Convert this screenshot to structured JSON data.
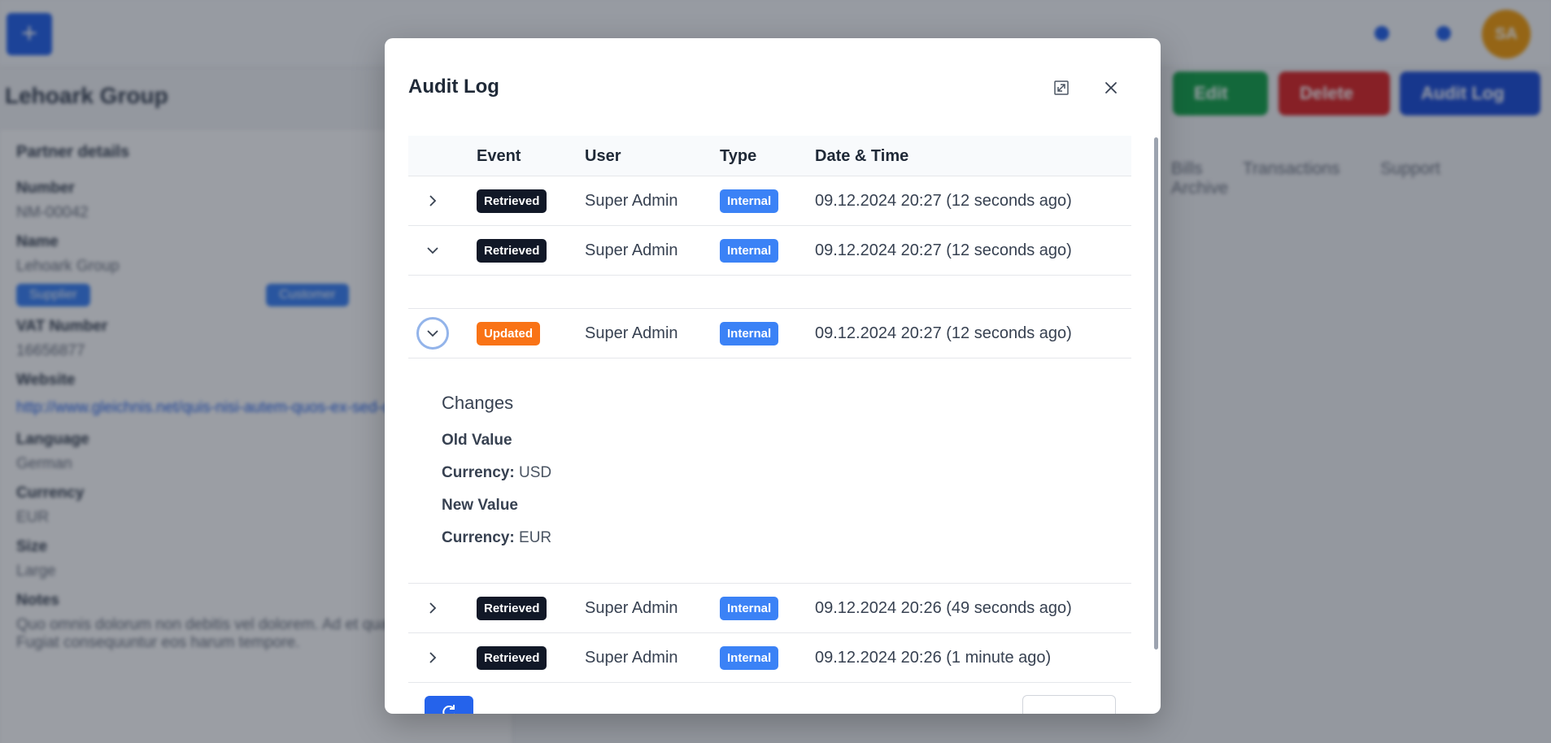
{
  "background": {
    "page_title": "Lehoark Group",
    "avatar_initials": "SA",
    "actions": [
      {
        "label": "Edit",
        "color": "#16a34a"
      },
      {
        "label": "Delete",
        "color": "#dc2626"
      },
      {
        "label": "Audit Log",
        "color": "#1d4ed8"
      }
    ],
    "tabs": [
      "Bills",
      "Transactions",
      "Support",
      "Archive"
    ],
    "details_heading": "Partner details",
    "fields": [
      {
        "label": "Number",
        "value": "NM-00042"
      },
      {
        "label": "Name",
        "value": "Lehoark Group"
      }
    ],
    "pills": [
      "Supplier",
      "Customer"
    ],
    "fields2": [
      {
        "label": "VAT Number",
        "value": "16656877"
      },
      {
        "label": "Website",
        "value": "http://www.gleichnis.net/quis-nisi-autem-quos-ex-sed-cum-pariatur"
      },
      {
        "label": "Language",
        "value": "German"
      },
      {
        "label": "Currency",
        "value": "EUR"
      },
      {
        "label": "Size",
        "value": "Large"
      },
      {
        "label": "Notes",
        "value": "Quo omnis dolorum non debitis vel dolorem. Ad et quas sunt sapiente. Fugiat consequuntur eos harum tempore."
      }
    ]
  },
  "modal": {
    "title": "Audit Log",
    "columns": {
      "event": "Event",
      "user": "User",
      "type": "Type",
      "datetime": "Date & Time"
    },
    "badge_colors": {
      "Retrieved": "#111827",
      "Updated": "#f97316",
      "Internal": "#3b82f6"
    },
    "rows": [
      {
        "event": "Retrieved",
        "user": "Super Admin",
        "type": "Internal",
        "datetime": "09.12.2024 20:27 (12 seconds ago)",
        "expanded": false
      },
      {
        "event": "Retrieved",
        "user": "Super Admin",
        "type": "Internal",
        "datetime": "09.12.2024 20:27 (12 seconds ago)",
        "expanded": true
      },
      {
        "event": "Updated",
        "user": "Super Admin",
        "type": "Internal",
        "datetime": "09.12.2024 20:27 (12 seconds ago)",
        "expanded": true
      },
      {
        "event": "Retrieved",
        "user": "Super Admin",
        "type": "Internal",
        "datetime": "09.12.2024 20:26 (49 seconds ago)",
        "expanded": false
      },
      {
        "event": "Retrieved",
        "user": "Super Admin",
        "type": "Internal",
        "datetime": "09.12.2024 20:26 (1 minute ago)",
        "expanded": false
      }
    ],
    "changes": {
      "title": "Changes",
      "old_label": "Old Value",
      "old_field": "Currency:",
      "old_value": "USD",
      "new_label": "New Value",
      "new_field": "Currency:",
      "new_value": "EUR"
    }
  }
}
